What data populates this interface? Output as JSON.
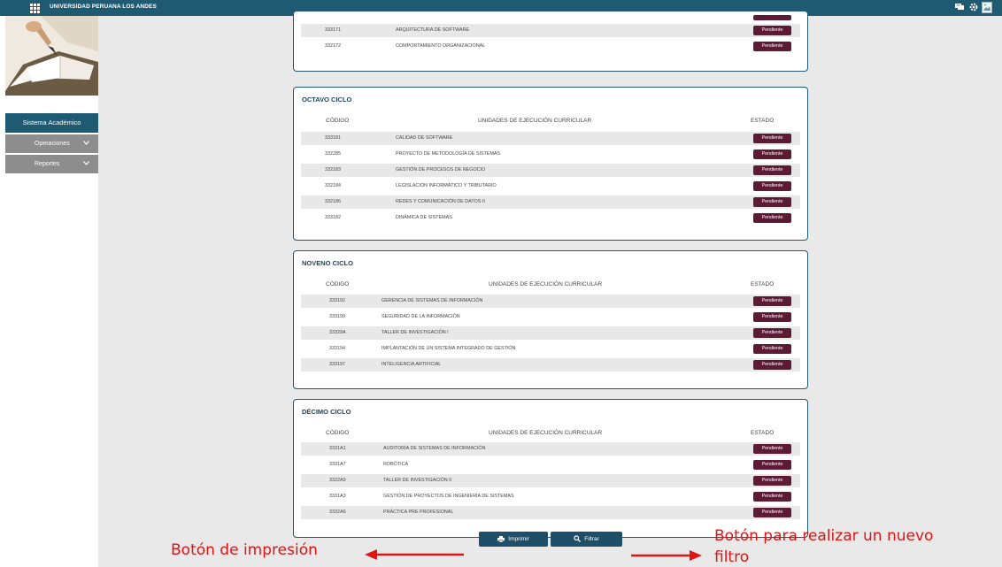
{
  "topbar": {
    "brand": "UNIVERSIDAD PERUANA LOS ANDES",
    "icons": [
      "apps-grid-icon",
      "chat-icon",
      "gear-icon",
      "broken-image-icon"
    ]
  },
  "sidebar": {
    "title": "Sistema Académico",
    "items": [
      {
        "label": "Operaciones",
        "icon": "chevron-down-icon"
      },
      {
        "label": "Reportes",
        "icon": "chevron-down-icon"
      }
    ]
  },
  "prev_rows": [
    {
      "code": "333171",
      "name": "ARQUITECTURA DE SOFTWARE",
      "status": "Pendiente"
    },
    {
      "code": "332172",
      "name": "COMPORTAMIENTO ORGANIZACIONAL",
      "status": "Pendiente"
    }
  ],
  "columns": {
    "code": "CÓDIGO",
    "unit": "UNIDADES DE EJECUCIÓN CURRICULAR",
    "status": "ESTADO"
  },
  "cycles": [
    {
      "title": "OCTAVO CICLO",
      "rows": [
        {
          "code": "333181",
          "name": "CALIDAD DE SOFTWARE",
          "status": "Pendiente"
        },
        {
          "code": "332285",
          "name": "PROYECTO DE METODOLOGÍA DE SISTEMAS",
          "status": "Pendiente"
        },
        {
          "code": "332183",
          "name": "GESTIÓN DE PROCESOS DE NEGOCIO",
          "status": "Pendiente"
        },
        {
          "code": "332184",
          "name": "LEGISLACIÓN INFORMÁTICO Y TRIBUTARIO",
          "status": "Pendiente"
        },
        {
          "code": "332186",
          "name": "REDES Y COMUNICACIÓN DE DATOS II",
          "status": "Pendiente"
        },
        {
          "code": "333182",
          "name": "DINÁMICA DE SISTEMAS",
          "status": "Pendiente"
        }
      ]
    },
    {
      "title": "NOVENO CICLO",
      "rows": [
        {
          "code": "333192",
          "name": "GERENCIA DE SISTEMAS DE INFORMACIÓN",
          "status": "Pendiente"
        },
        {
          "code": "333199",
          "name": "SEGURIDAD DE LA INFORMACIÓN",
          "status": "Pendiente"
        },
        {
          "code": "33329A",
          "name": "TALLER DE INVESTIGACIÓN I",
          "status": "Pendiente"
        },
        {
          "code": "333194",
          "name": "IMPLANTACIÓN DE UN SISTEMA INTEGRADO DE GESTIÓN",
          "status": "Pendiente"
        },
        {
          "code": "333197",
          "name": "INTELIGENCIA ARTIFICIAL",
          "status": "Pendiente"
        }
      ]
    },
    {
      "title": "DÉCIMO CICLO",
      "rows": [
        {
          "code": "3331A1",
          "name": "AUDITORÍA DE SISTEMAS DE INFORMACIÓN",
          "status": "Pendiente"
        },
        {
          "code": "3331A7",
          "name": "ROBÓTICA",
          "status": "Pendiente"
        },
        {
          "code": "3322A9",
          "name": "TALLER DE INVESTIGACIÓN II",
          "status": "Pendiente"
        },
        {
          "code": "3331A3",
          "name": "GESTIÓN DE PROYECTOS DE INGENIERÍA DE SISTEMAS",
          "status": "Pendiente"
        },
        {
          "code": "3332A6",
          "name": "PRÁCTICA PRE PROFESIONAL",
          "status": "Pendiente"
        }
      ]
    }
  ],
  "buttons": {
    "print": "Imprimir",
    "filter": "Filtrar"
  },
  "annotations": {
    "print": "Botón de impresión",
    "filter_line1": "Botón para realizar un nuevo",
    "filter_line2": "filtro"
  },
  "colors": {
    "header": "#1f5a73",
    "status_badge": "#5d1a35",
    "annotation": "#e11414",
    "button": "#1f4f68"
  }
}
